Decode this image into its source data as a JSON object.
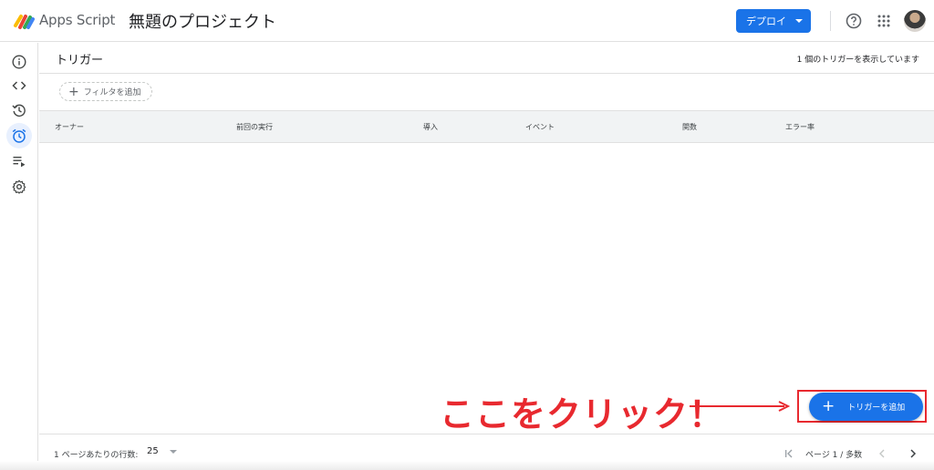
{
  "header": {
    "app_name": "Apps Script",
    "project_title": "無題のプロジェクト",
    "deploy_label": "デプロイ",
    "icons": [
      "apps-script-logo",
      "help-icon",
      "apps-grid-icon",
      "avatar"
    ]
  },
  "sidebar": {
    "items": [
      {
        "name": "overview",
        "icon": "info-icon",
        "active": false
      },
      {
        "name": "editor",
        "icon": "code-icon",
        "active": false
      },
      {
        "name": "executions-history",
        "icon": "history-icon",
        "active": false
      },
      {
        "name": "triggers",
        "icon": "alarm-clock-icon",
        "active": true
      },
      {
        "name": "executions",
        "icon": "playlist-play-icon",
        "active": false
      },
      {
        "name": "settings",
        "icon": "gear-icon",
        "active": false
      }
    ]
  },
  "section": {
    "title": "トリガー",
    "count_text": "1 個のトリガーを表示しています"
  },
  "filter": {
    "label": "フィルタを追加"
  },
  "table": {
    "columns": [
      "オーナー",
      "前回の実行",
      "導入",
      "イベント",
      "関数",
      "エラー率"
    ],
    "rows": []
  },
  "footer": {
    "rows_per_page_label": "1 ページあたりの行数:",
    "rows_per_page_value": "25",
    "page_text": "ページ 1 / 多数"
  },
  "fab": {
    "label": "トリガーを追加"
  },
  "annotation": {
    "text": "ここをクリック！"
  },
  "colors": {
    "accent": "#1a73e8",
    "annotation_red": "#e8292f",
    "active_nav_bg": "#e8f0fe"
  }
}
